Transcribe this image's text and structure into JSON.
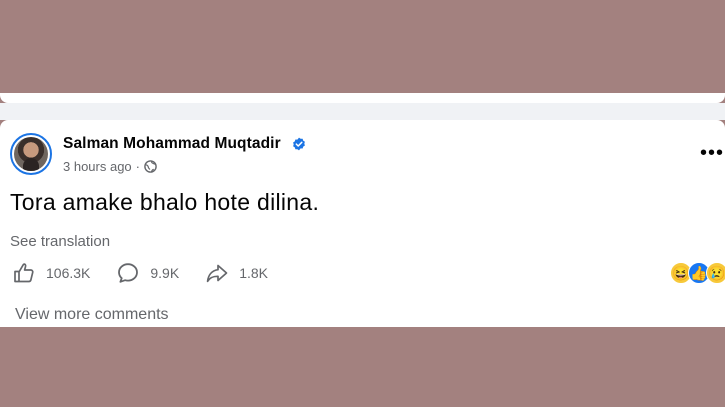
{
  "post": {
    "author": "Salman Mohammad Muqtadir",
    "verified": true,
    "timestamp": "3 hours ago",
    "separator": "·",
    "audience_icon": "globe-icon",
    "text": "Tora amake bhalo hote dilina.",
    "translation_label": "See translation",
    "more_label": "•••",
    "stats": {
      "likes": "106.3K",
      "comments": "9.9K",
      "shares": "1.8K"
    },
    "reactions": [
      "haha",
      "like",
      "sad"
    ],
    "view_more_comments": "View more comments"
  },
  "colors": {
    "verified": "#1b74e4",
    "secondary_text": "#65676b",
    "primary_text": "#050505",
    "backdrop": "#a3817f"
  }
}
